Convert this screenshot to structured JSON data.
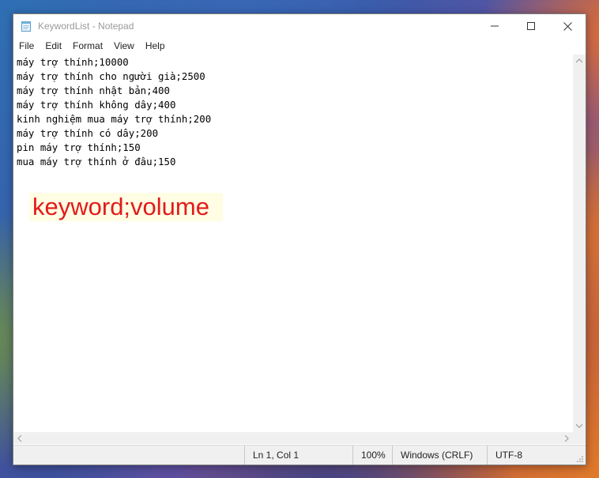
{
  "window": {
    "title": "KeywordList - Notepad"
  },
  "menu": {
    "items": [
      "File",
      "Edit",
      "Format",
      "View",
      "Help"
    ]
  },
  "editor": {
    "lines": [
      "máy trợ thính;10000",
      "máy trợ thính cho người già;2500",
      "máy trợ thính nhật bản;400",
      "máy trợ thính không dây;400",
      "kinh nghiệm mua máy trợ thính;200",
      "máy trợ thính có dây;200",
      "pin máy trợ thính;150",
      "mua máy trợ thính ở đâu;150"
    ]
  },
  "annotation": {
    "text": "keyword;volume",
    "color": "#e21b1b"
  },
  "status": {
    "position": "Ln 1, Col 1",
    "zoom": "100%",
    "line_ending": "Windows (CRLF)",
    "encoding": "UTF-8"
  },
  "icons": {
    "app": "notepad-icon",
    "minimize": "minimize-icon",
    "maximize": "maximize-icon",
    "close": "close-icon"
  }
}
